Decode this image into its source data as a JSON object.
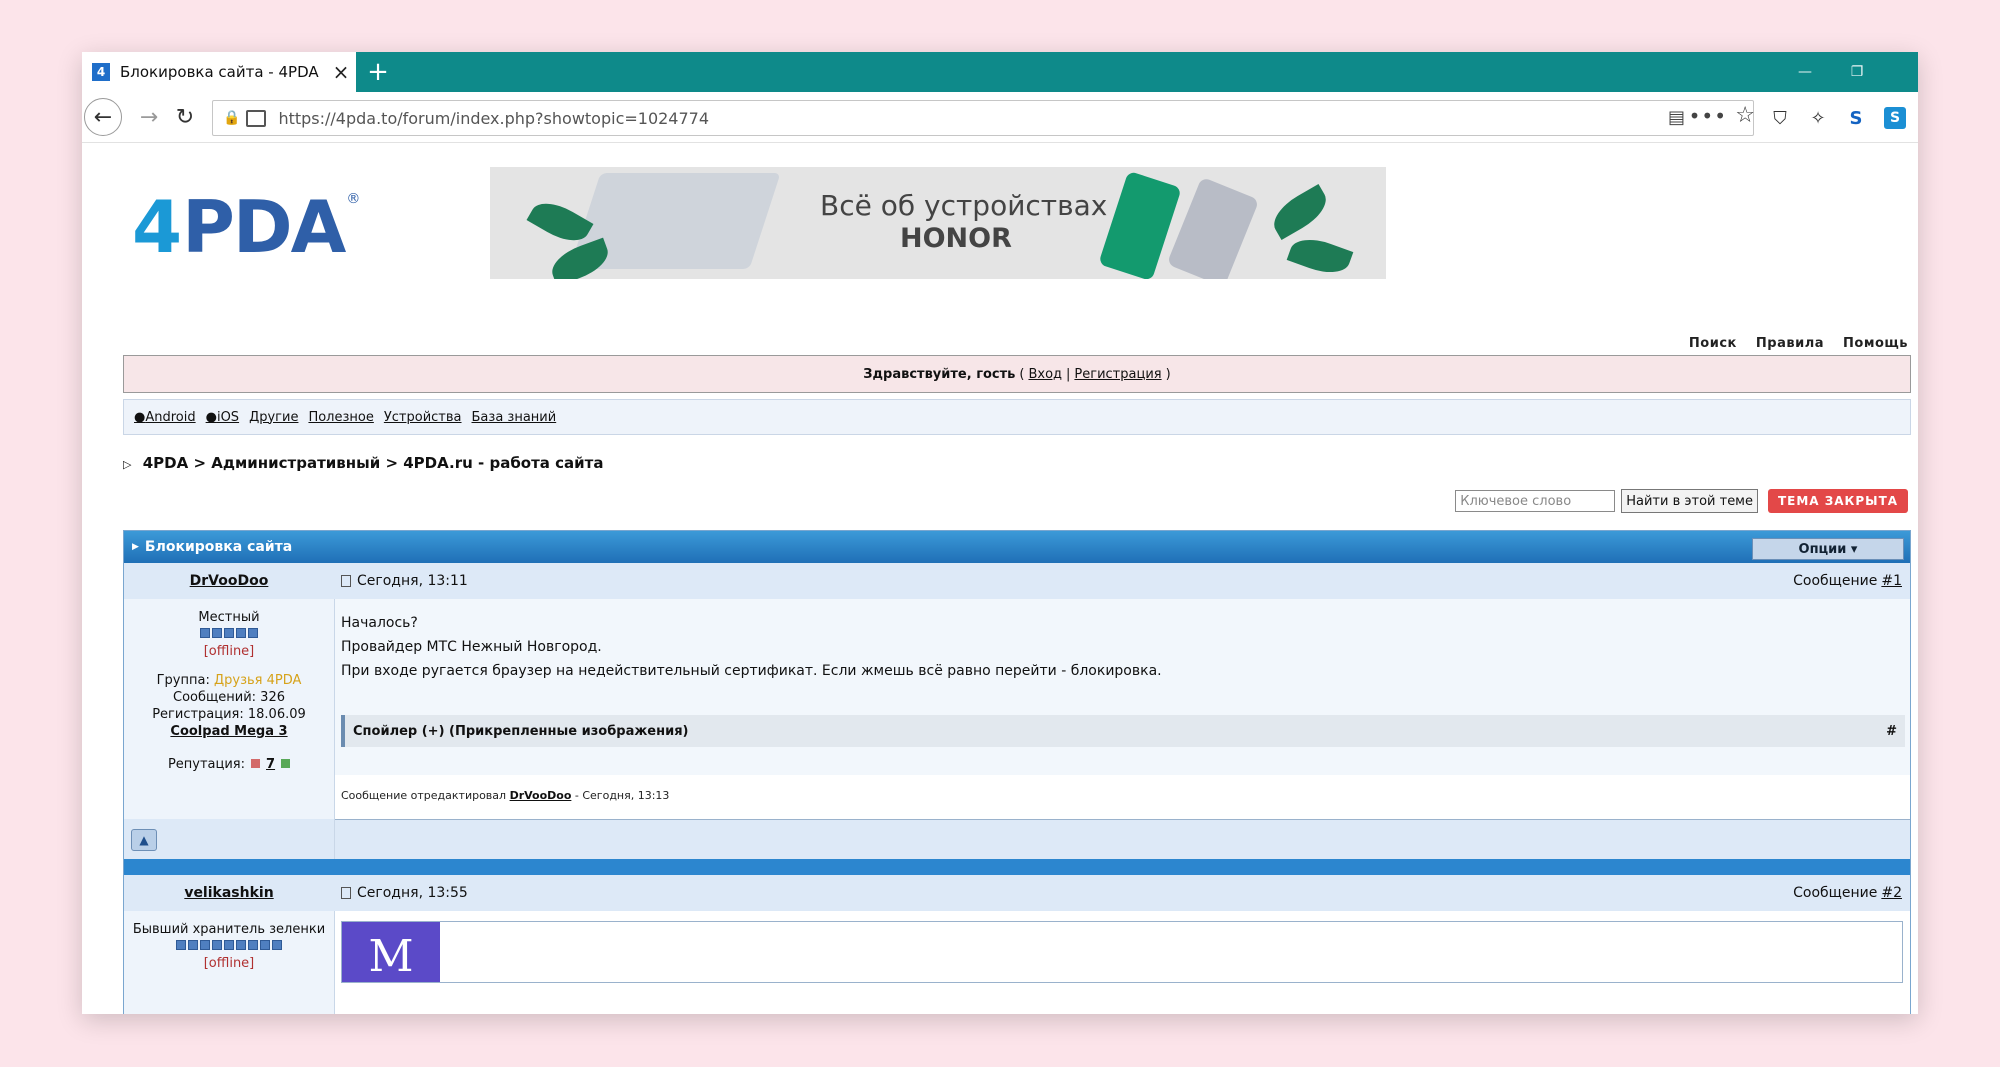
{
  "browser": {
    "tab_title": "Блокировка сайта - 4PDA",
    "tab_favicon": "4",
    "new_tab": "+",
    "url": "https://4pda.to/forum/index.php?showtopic=1024774",
    "minimize": "—",
    "restore": "❐",
    "toolbar_s": "S",
    "toolbar_s2": "S"
  },
  "site": {
    "logo_four": "4",
    "logo_text": "PDA",
    "logo_reg": "®",
    "banner_line1": "Всё об устройствах",
    "banner_line2": "HONOR",
    "toplinks": [
      "Поиск",
      "Правила",
      "Помощь"
    ],
    "welcome": {
      "greeting": "Здравствуйте, гость",
      "open_paren": "(",
      "login": "Вход",
      "sep": "|",
      "register": "Регистрация",
      "close_paren": ")"
    },
    "categories": [
      "Android",
      "iOS",
      "Другие",
      "Полезное",
      "Устройства",
      "База знаний"
    ],
    "breadcrumb": {
      "marker": "▷",
      "items": [
        "4PDA",
        "Административный",
        "4PDA.ru - работа сайта"
      ],
      "sep": ">"
    },
    "search": {
      "placeholder": "Ключевое слово",
      "find_button": "Найти в этой теме",
      "closed_button": "ТЕМА ЗАКРЫТА"
    }
  },
  "topic": {
    "title": "Блокировка сайта",
    "options": "Опции ▾",
    "posts": [
      {
        "author": "DrVooDoo",
        "date": "Сегодня, 13:11",
        "msg_label": "Сообщение",
        "msg_num": "#1",
        "rank": "Местный",
        "status": "[offline]",
        "group_label": "Группа:",
        "group": "Друзья 4PDA",
        "messages": "Сообщений: 326",
        "registered": "Регистрация: 18.06.09",
        "device": "Coolpad Mega 3",
        "rep_label": "Репутация:",
        "rep_value": "7",
        "lines": [
          "Началось?",
          "Провайдер МТС Нежный Новгород.",
          "При входе ругается браузер на недействительный сертификат. Если жмешь всё равно перейти - блокировка."
        ],
        "spoiler": "Спойлер (+) (Прикрепленные изображения)",
        "spoiler_hash": "#",
        "edited_prefix": "Сообщение отредактировал",
        "edited_by": "DrVooDoo",
        "edited_suffix": "- Сегодня, 13:13"
      },
      {
        "author": "velikashkin",
        "date": "Сегодня, 13:55",
        "msg_label": "Сообщение",
        "msg_num": "#2",
        "rank": "Бывший хранитель зеленки",
        "status": "[offline]",
        "m_letter": "M"
      }
    ]
  },
  "colors": {
    "tabbar": "#0e8a8a",
    "topic_header": "#1f6fb6",
    "closed_button": "#e34848",
    "page_background": "#fce4ea"
  }
}
